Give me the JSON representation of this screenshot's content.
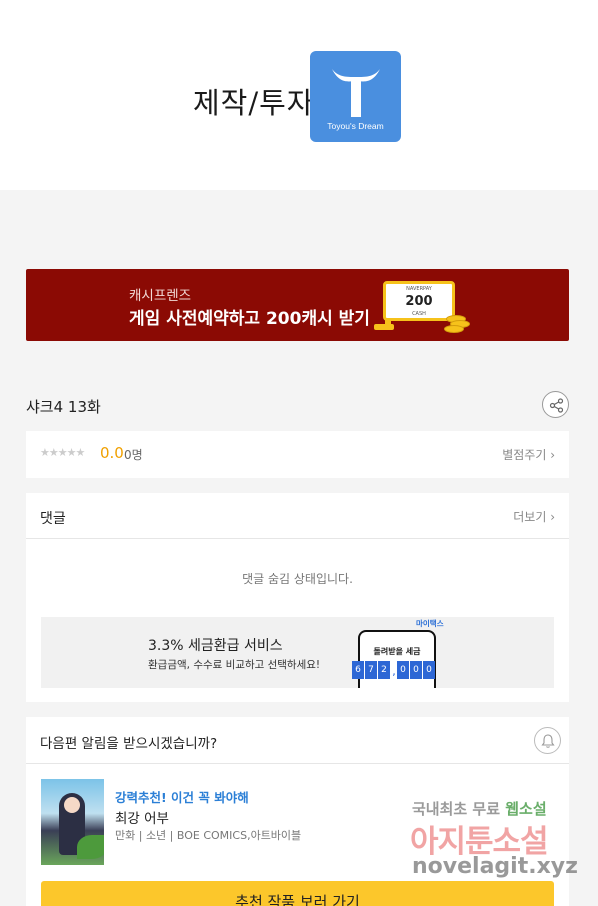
{
  "credit": {
    "label": "제작/투자",
    "logo_text": "Toyou's Dream",
    "logo_color": "#4a8fdf"
  },
  "banner": {
    "subtitle": "캐시프렌즈",
    "title": "게임 사전예약하고 200캐시 받기",
    "coupon_small": "NAVERPAY",
    "coupon_value": "200",
    "coupon_unit": "CASH",
    "bg_color": "#8b0a04"
  },
  "episode": {
    "title": "샤크4 13화"
  },
  "rating": {
    "stars": "★★★★★",
    "score": "0.0",
    "count": "0명",
    "rate_link": "별점주기 ›"
  },
  "comments": {
    "header": "댓글",
    "more_link": "더보기 ›",
    "hidden_message": "댓글 숨김 상태입니다."
  },
  "ad": {
    "brand": "마이택스",
    "title": "3.3% 세금환급 서비스",
    "description": "환급금액, 수수료 비교하고 선택하세요!",
    "phone_label": "돌려받을 세금",
    "digits": [
      "6",
      "7",
      "2",
      "0",
      "0",
      "0"
    ]
  },
  "notify": {
    "question": "다음편 알림을 받으시겠습니까?"
  },
  "recommendation": {
    "tag": "강력추천! 이건 꼭 봐야해",
    "title": "최강 어부",
    "meta": "만화 | 소년 | BOE COMICS,아트바이블",
    "cta_label": "추천 작품 보러 가기",
    "cta_color": "#fcc72b"
  },
  "watermark": {
    "line1_a": "국내최초 무료 ",
    "line1_b": "웹소설",
    "line2": "아지툰소설",
    "line3": "novelagit.xyz"
  }
}
